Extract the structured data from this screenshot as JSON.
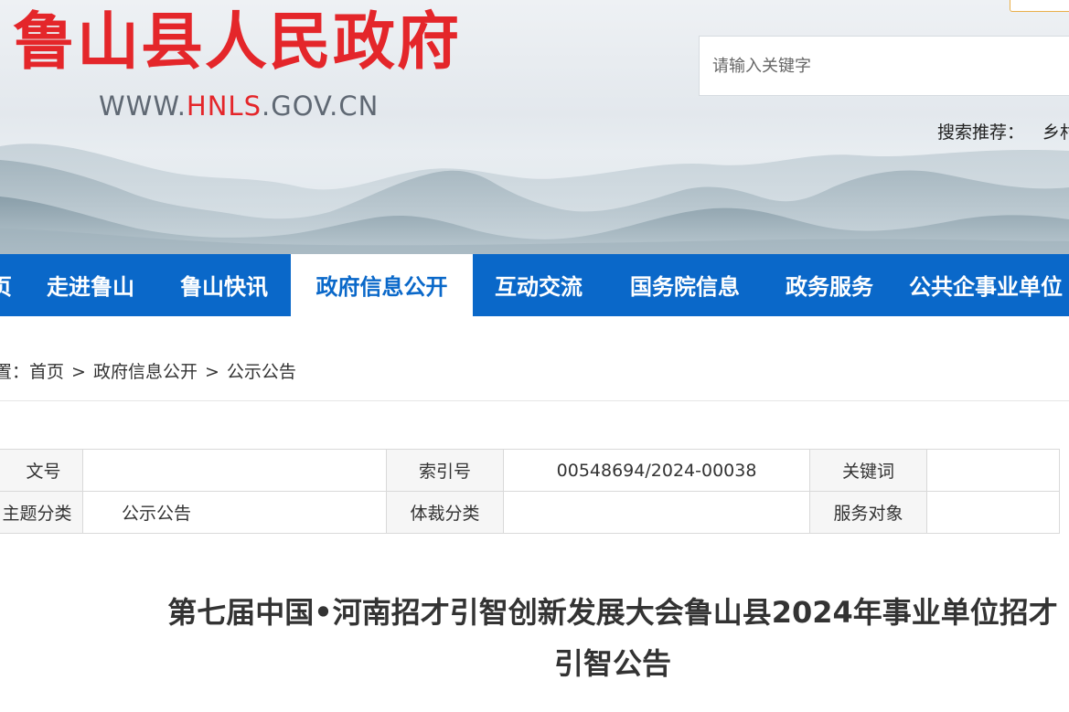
{
  "header": {
    "site_title": "鲁山县人民政府",
    "url_prefix": "WWW.",
    "url_highlight": "HNLS",
    "url_suffix": ".GOV.CN"
  },
  "search": {
    "placeholder": "请输入关键字",
    "hint_label": "搜索推荐：",
    "hint_keyword": "乡村"
  },
  "nav": {
    "items": [
      {
        "label": "页"
      },
      {
        "label": "走进鲁山"
      },
      {
        "label": "鲁山快讯"
      },
      {
        "label": "政府信息公开",
        "active": true
      },
      {
        "label": "互动交流"
      },
      {
        "label": "国务院信息"
      },
      {
        "label": "政务服务"
      },
      {
        "label": "公共企事业单位"
      }
    ]
  },
  "breadcrumb": {
    "prefix": "置：",
    "items": [
      "首页",
      "政府信息公开",
      "公示公告"
    ],
    "separator": ">"
  },
  "meta": {
    "row1": {
      "label1": "文号",
      "value1": "",
      "label2": "索引号",
      "value2": "00548694/2024-00038",
      "label3": "关键词",
      "value3": ""
    },
    "row2": {
      "label1": "主题分类",
      "value1": "公示公告",
      "label2": "体裁分类",
      "value2": "",
      "label3": "服务对象",
      "value3": ""
    }
  },
  "article": {
    "title": "第七届中国•河南招才引智创新发展大会鲁山县2024年事业单位招才引智公告"
  },
  "colors": {
    "brand_red": "#e4262a",
    "nav_blue": "#0a68c9",
    "url_gray": "#5f6873"
  }
}
